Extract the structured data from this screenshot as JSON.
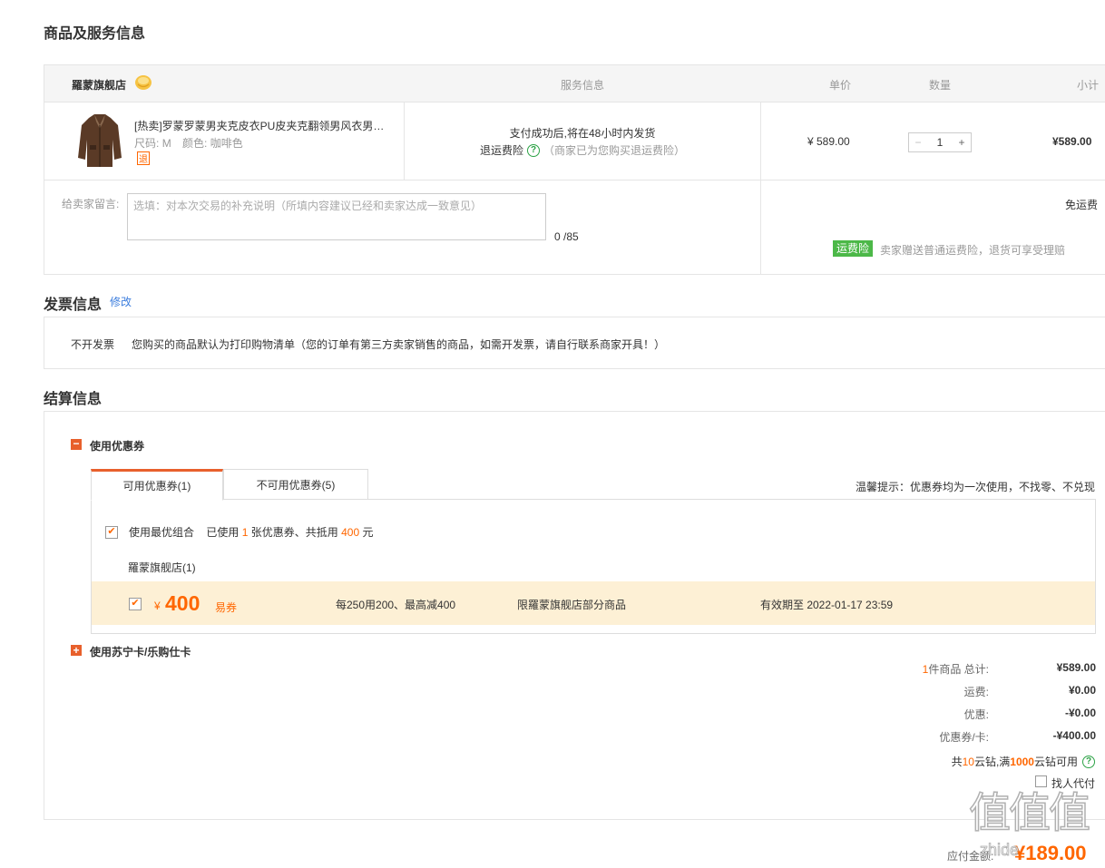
{
  "section_goods": {
    "title": "商品及服务信息",
    "header": {
      "store_name": "羅蒙旗舰店",
      "service_col": "服务信息",
      "price_col": "单价",
      "qty_col": "数量",
      "subtotal_col": "小计"
    },
    "item": {
      "name": "[热卖]罗蒙罗蒙男夹克皮衣PU皮夹克翻领男风衣男…",
      "size_label": "尺码:",
      "size_value": "M",
      "color_label": "颜色:",
      "color_value": "咖啡色",
      "return_badge": "退",
      "delivery_text": "支付成功后,将在48小时内发货",
      "insurance_label": "退运费险",
      "insurance_note": "（商家已为您购买退运费险）",
      "price": "¥ 589.00",
      "quantity": "1",
      "minus": "−",
      "plus": "+",
      "subtotal": "¥589.00"
    },
    "message": {
      "label": "给卖家留言:",
      "placeholder": "选填：对本次交易的补充说明（所填内容建议已经和卖家达成一致意见）",
      "counter": "0 /85"
    },
    "shipping": {
      "free_label": "免运费",
      "badge": "运费险",
      "desc": "卖家赠送普通运费险，退货可享受理赔"
    }
  },
  "section_invoice": {
    "title": "发票信息",
    "edit_link": "修改",
    "type": "不开发票",
    "desc": "您购买的商品默认为打印购物清单（您的订单有第三方卖家销售的商品，如需开发票，请自行联系商家开具！）"
  },
  "section_settle": {
    "title": "结算信息",
    "coupon_toggle": "−",
    "coupon_title": "使用优惠券",
    "tabs": [
      "可用优惠券(1)",
      "不可用优惠券(5)"
    ],
    "tip": "温馨提示：优惠券均为一次使用，不找零、不兑现",
    "best_combo": {
      "label": "使用最优组合",
      "used_prefix": "已使用",
      "used_count": "1",
      "used_middle": "张优惠券、共抵用",
      "used_amount": "400",
      "used_suffix": "元"
    },
    "store_group": "羅蒙旗舰店(1)",
    "coupon": {
      "currency": "¥",
      "amount": "400",
      "type": "易券",
      "rule": "每250用200、最高减400",
      "scope": "限羅蒙旗舰店部分商品",
      "expiry": "有效期至 2022-01-17 23:59"
    },
    "card_toggle": "+",
    "card_title": "使用苏宁卡/乐购仕卡"
  },
  "summary": {
    "count": "1",
    "count_label": "件商品 总计:",
    "total": "¥589.00",
    "shipping_label": "运费:",
    "shipping": "¥0.00",
    "discount_label": "优惠:",
    "discount": "-¥0.00",
    "coupon_label": "优惠券/卡:",
    "coupon": "-¥400.00",
    "cloud_prefix": "共",
    "cloud_count": "10",
    "cloud_middle": "云钻,满",
    "cloud_threshold": "1000",
    "cloud_suffix": "云钻可用",
    "proxy_pay": "找人代付",
    "payable_label": "应付金额:",
    "payable": "¥189.00"
  },
  "watermark": {
    "logo": "值",
    "site": "zhide"
  },
  "colors": {
    "orange": "#ff6600",
    "coupon_bg": "#fdf0d5",
    "green": "#4cb848",
    "header_bg": "#f5f5f5"
  }
}
